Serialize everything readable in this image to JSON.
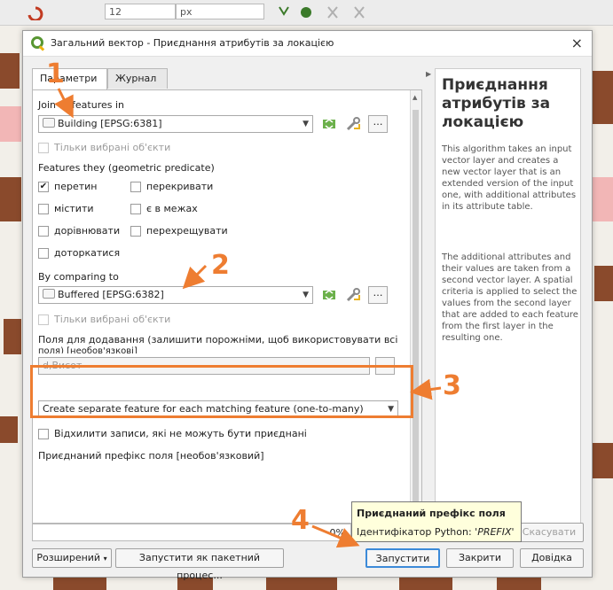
{
  "toolbar": {
    "font_size": "12",
    "unit": "px"
  },
  "dialog": {
    "title": "Загальний вектор - Приєднання атрибутів за локацією",
    "close": "×"
  },
  "tabs": [
    "Параметри",
    "Журнал"
  ],
  "params": {
    "join_label": "Join to features in",
    "join_layer": "Building [EPSG:6381]",
    "selected_only_1": "Тільки вибрані об'єкти",
    "predicate_label": "Features they (geometric predicate)",
    "predicates": [
      {
        "label": "перетин",
        "checked": true
      },
      {
        "label": "перекривати",
        "checked": false
      },
      {
        "label": "містити",
        "checked": false
      },
      {
        "label": "є в межах",
        "checked": false
      },
      {
        "label": "дорівнювати",
        "checked": false
      },
      {
        "label": "перехрещувати",
        "checked": false
      },
      {
        "label": "доторкатися",
        "checked": false
      }
    ],
    "compare_label": "By comparing to",
    "compare_layer": "Buffered [EPSG:6382]",
    "selected_only_2": "Тільки вибрані об'єкти",
    "fields_label_1": "Поля для додавання (залишити порожніми, щоб використовувати всі",
    "fields_label_2": "поля) [необов'язкові]",
    "fields_value": "d,Висот",
    "join_type": "Create separate feature for each matching feature (one-to-many)",
    "discard_label": "Відхилити записи, які не можуть бути приєднані",
    "prefix_label": "Приєднаний префікс поля [необов'язковий]"
  },
  "help": {
    "heading": "Приєднання атрибутів за локацією",
    "p1": "This algorithm takes an input vector layer and creates a new vector layer that is an extended version of the input one, with additional attributes in its attribute table.",
    "p2": "The additional attributes and their values are taken from a second vector layer. A spatial criteria is applied to select the values from the second layer that are added to each feature from the first layer in the resulting one."
  },
  "progress": {
    "value": 0,
    "text": "0%"
  },
  "tooltip": {
    "title": "Приєднаний префікс поля",
    "body_prefix": "Ідентифікатор Python: '",
    "body_code": "PREFIX",
    "body_suffix": "'"
  },
  "buttons": {
    "cancel": "Скасувати",
    "advanced": "Розширений",
    "batch": "Запустити як пакетний процес...",
    "run": "Запустити",
    "close": "Закрити",
    "help": "Довідка"
  },
  "annotations": [
    "1",
    "2",
    "3",
    "4"
  ],
  "colors": {
    "annotation": "#ee7d31",
    "qgis_green": "#589632"
  }
}
